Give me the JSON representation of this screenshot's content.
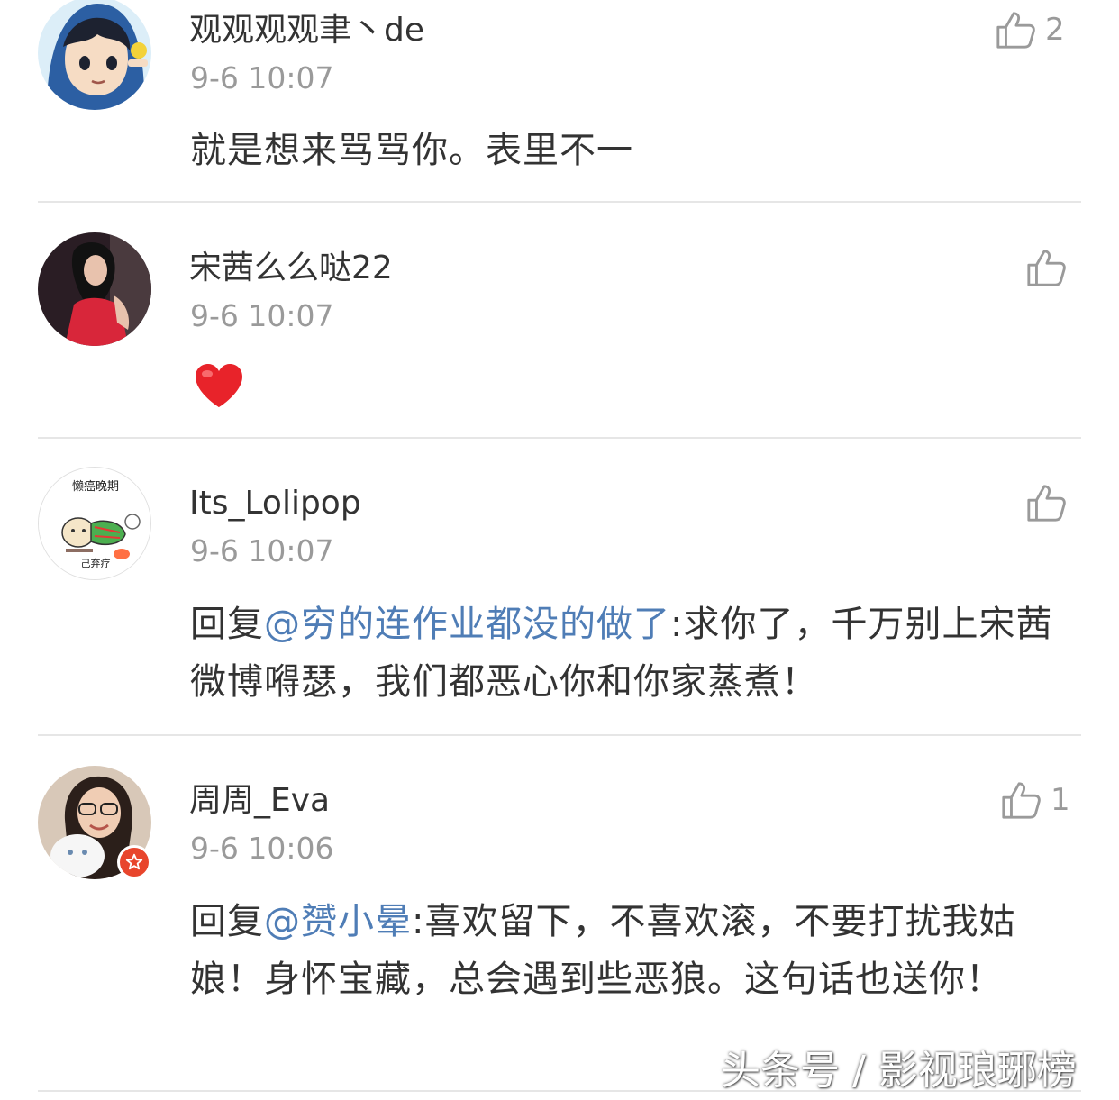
{
  "comments": [
    {
      "username": "观观观观聿丶de",
      "time": "9-6 10:07",
      "text": "就是想来骂骂你。表里不一",
      "like_count": "2"
    },
    {
      "username": "宋茜么么哒22",
      "time": "9-6 10:07",
      "emoji": "heart-emoji",
      "like_count": ""
    },
    {
      "username": "Its_Lolipop",
      "time": "9-6 10:07",
      "avatar_text_top": "懒癌晚期",
      "avatar_text_bottom": "己弃疗",
      "reply_prefix": "回复",
      "mention": "@穷的连作业都没的做了",
      "text": ":求你了，千万别上宋茜微博嘚瑟，我们都恶心你和你家蒸煮！",
      "like_count": ""
    },
    {
      "username": "周周_Eva",
      "time": "9-6 10:06",
      "reply_prefix": "回复",
      "mention": "@赟小晕",
      "text": ":喜欢留下，不喜欢滚，不要打扰我姑娘！身怀宝藏，总会遇到些恶狼。这句话也送你！",
      "like_count": "1",
      "verified": true
    }
  ],
  "watermark": "头条号 / 影视琅琊榜",
  "colors": {
    "mention": "#4f7db6",
    "text": "#333333",
    "meta": "#9a9a9a",
    "divider": "#e6e6e6",
    "badge": "#e8452c"
  }
}
